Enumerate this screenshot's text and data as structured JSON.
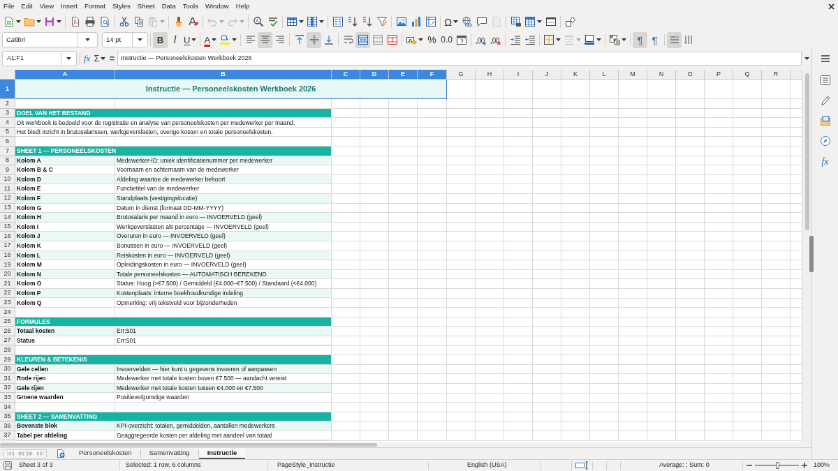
{
  "menu_bar": {
    "items": [
      "File",
      "Edit",
      "View",
      "Insert",
      "Format",
      "Styles",
      "Sheet",
      "Data",
      "Tools",
      "Window",
      "Help"
    ]
  },
  "standard_toolbar": [
    {
      "disabled": false
    },
    {
      "disabled": false
    },
    {
      "disabled": false
    },
    {
      "disabled": false
    },
    {
      "disabled": false
    },
    {
      "disabled": false
    },
    {
      "disabled": false
    },
    {
      "disabled": false
    },
    {
      "disabled": true
    },
    {
      "disabled": false
    },
    {
      "disabled": false
    },
    {
      "disabled": true
    },
    {
      "disabled": true
    },
    {
      "disabled": false
    },
    {
      "disabled": false
    },
    {
      "disabled": false
    },
    {
      "disabled": false
    },
    {
      "disabled": false
    },
    {
      "disabled": false
    },
    {
      "disabled": false
    },
    {
      "disabled": false
    },
    {
      "disabled": false
    },
    {
      "disabled": false
    },
    {
      "disabled": false
    },
    {
      "label": "Ω",
      "disabled": false
    },
    {
      "disabled": false
    },
    {
      "disabled": false
    },
    {
      "disabled": true
    },
    {
      "disabled": false
    },
    {
      "disabled": false
    },
    {
      "disabled": false
    },
    {
      "disabled": false
    }
  ],
  "formatting_toolbar": {
    "font_name": "Calibri",
    "font_size": "14 pt",
    "buttons": [
      {
        "label": "B",
        "on": true,
        "disabled": false
      },
      {
        "label": "I",
        "on": false,
        "disabled": false
      },
      {
        "label": "U",
        "on": false,
        "disabled": false
      },
      {
        "label": "A",
        "on": false,
        "disabled": false
      },
      {
        "on": false,
        "disabled": false
      },
      {
        "on": false,
        "disabled": false
      },
      {
        "on": true,
        "disabled": false
      },
      {
        "on": false,
        "disabled": false
      },
      {
        "on": false,
        "disabled": false
      },
      {
        "on": true,
        "disabled": false
      },
      {
        "on": false,
        "disabled": false
      },
      {
        "on": false,
        "disabled": false
      },
      {
        "on": true,
        "disabled": false
      },
      {
        "on": false,
        "disabled": false
      },
      {
        "on": false,
        "disabled": false
      },
      {
        "on": false,
        "disabled": false
      },
      {
        "label": "%",
        "on": false,
        "disabled": false
      },
      {
        "label": "0.0",
        "on": false,
        "disabled": false
      },
      {
        "on": false,
        "disabled": false
      },
      {
        "on": false,
        "disabled": false
      },
      {
        "on": false,
        "disabled": false
      },
      {
        "on": false,
        "disabled": false
      },
      {
        "on": false,
        "disabled": false
      },
      {
        "on": false,
        "disabled": false
      },
      {
        "on": false,
        "disabled": true
      },
      {
        "on": false,
        "disabled": false
      },
      {
        "on": false,
        "disabled": false
      },
      {
        "label": "¶",
        "on": true,
        "disabled": false
      },
      {
        "label": "¶",
        "on": false,
        "disabled": false
      },
      {
        "on": true,
        "disabled": false
      },
      {
        "on": false,
        "disabled": false
      }
    ]
  },
  "formula_bar": {
    "name_box": "A1:F1",
    "function_wizard": "fx",
    "sum": "Σ",
    "equals": "=",
    "content": "Instructie — Personeelskosten Werkboek 2026"
  },
  "sidebar": {
    "functions_label": "fx"
  },
  "columns": [
    {
      "name": "A",
      "selected": true
    },
    {
      "name": "B",
      "selected": true
    },
    {
      "name": "C",
      "selected": true
    },
    {
      "name": "D",
      "selected": true
    },
    {
      "name": "E",
      "selected": true
    },
    {
      "name": "F",
      "selected": true
    },
    {
      "name": "G",
      "selected": false
    },
    {
      "name": "H",
      "selected": false
    },
    {
      "name": "I",
      "selected": false
    },
    {
      "name": "J",
      "selected": false
    },
    {
      "name": "K",
      "selected": false
    },
    {
      "name": "L",
      "selected": false
    },
    {
      "name": "M",
      "selected": false
    },
    {
      "name": "N",
      "selected": false
    },
    {
      "name": "O",
      "selected": false
    },
    {
      "name": "P",
      "selected": false
    },
    {
      "name": "Q",
      "selected": false
    },
    {
      "name": "R",
      "selected": false
    }
  ],
  "rows": [
    {
      "number": "1",
      "selected": true,
      "kind": "title",
      "text": "Instructie — Personeelskosten Werkboek 2026"
    },
    {
      "number": "2",
      "selected": false,
      "kind": "blank"
    },
    {
      "number": "3",
      "selected": false,
      "kind": "section",
      "text": "DOEL VAN HET BESTAND"
    },
    {
      "number": "4",
      "selected": false,
      "kind": "note",
      "text": "Dit werkboek is bedoeld voor de registratie en analyse van personeelskosten per medewerker per maand."
    },
    {
      "number": "5",
      "selected": false,
      "kind": "note",
      "text": "Het biedt inzicht in brutosalarissen, werkgeverslasten, overige kosten en totale personeelskosten."
    },
    {
      "number": "6",
      "selected": false,
      "kind": "blank"
    },
    {
      "number": "7",
      "selected": false,
      "kind": "section",
      "text": "SHEET 1 — PERSONEELSKOSTEN"
    },
    {
      "number": "8",
      "selected": false,
      "kind": "entry",
      "shaded": true,
      "label": "Kolom A",
      "description": "Medewerker-ID: uniek identificatienummer per medewerker"
    },
    {
      "number": "9",
      "selected": false,
      "kind": "entry",
      "shaded": false,
      "label": "Kolom B & C",
      "description": "Voornaam en achternaam van de medewerker"
    },
    {
      "number": "10",
      "selected": false,
      "kind": "entry",
      "shaded": true,
      "label": "Kolom D",
      "description": "Afdeling waartoe de medewerker behoort"
    },
    {
      "number": "11",
      "selected": false,
      "kind": "entry",
      "shaded": false,
      "label": "Kolom E",
      "description": "Functietitel van de medewerker"
    },
    {
      "number": "12",
      "selected": false,
      "kind": "entry",
      "shaded": true,
      "label": "Kolom F",
      "description": "Standplaats (vestigingslocatie)"
    },
    {
      "number": "13",
      "selected": false,
      "kind": "entry",
      "shaded": false,
      "label": "Kolom G",
      "description": "Datum in dienst (formaat DD-MM-YYYY)"
    },
    {
      "number": "14",
      "selected": false,
      "kind": "entry",
      "shaded": true,
      "label": "Kolom H",
      "description": "Brutosalaris per maand in euro — INVOERVELD (geel)"
    },
    {
      "number": "15",
      "selected": false,
      "kind": "entry",
      "shaded": false,
      "label": "Kolom I",
      "description": "Werkgeverslasten als percentage — INVOERVELD (geel)"
    },
    {
      "number": "16",
      "selected": false,
      "kind": "entry",
      "shaded": true,
      "label": "Kolom J",
      "description": "Overuren in euro — INVOERVELD (geel)"
    },
    {
      "number": "17",
      "selected": false,
      "kind": "entry",
      "shaded": false,
      "label": "Kolom K",
      "description": "Bonussen in euro — INVOERVELD (geel)"
    },
    {
      "number": "18",
      "selected": false,
      "kind": "entry",
      "shaded": true,
      "label": "Kolom L",
      "description": "Reiskosten in euro — INVOERVELD (geel)"
    },
    {
      "number": "19",
      "selected": false,
      "kind": "entry",
      "shaded": false,
      "label": "Kolom M",
      "description": "Opleidingskosten in euro — INVOERVELD (geel)"
    },
    {
      "number": "20",
      "selected": false,
      "kind": "entry",
      "shaded": true,
      "label": "Kolom N",
      "description": "Totale personeelskosten — AUTOMATISCH BEREKEND"
    },
    {
      "number": "21",
      "selected": false,
      "kind": "entry",
      "shaded": false,
      "label": "Kolom O",
      "description": "Status: Hoog (>€7.500) / Gemiddeld (€4.000–€7.500) / Standaard (<€4.000)"
    },
    {
      "number": "22",
      "selected": false,
      "kind": "entry",
      "shaded": true,
      "label": "Kolom P",
      "description": "Kostenplaats: interne boekhoudkundige indeling"
    },
    {
      "number": "23",
      "selected": false,
      "kind": "entry",
      "shaded": false,
      "label": "Kolom Q",
      "description": "Opmerking: vrij tekstveld voor bijzonderheden"
    },
    {
      "number": "24",
      "selected": false,
      "kind": "blank"
    },
    {
      "number": "25",
      "selected": false,
      "kind": "section",
      "text": "FORMULES"
    },
    {
      "number": "26",
      "selected": false,
      "kind": "entry",
      "shaded": true,
      "label": "Totaal kosten",
      "description": "Err:501"
    },
    {
      "number": "27",
      "selected": false,
      "kind": "entry",
      "shaded": false,
      "label": "Status",
      "description": "Err:501"
    },
    {
      "number": "28",
      "selected": false,
      "kind": "blank"
    },
    {
      "number": "29",
      "selected": false,
      "kind": "section",
      "text": "KLEUREN & BETEKENIS"
    },
    {
      "number": "30",
      "selected": false,
      "kind": "entry",
      "shaded": true,
      "label": "Gele cellen",
      "description": "Invoervelden — hier kunt u gegevens invoeren of aanpassen"
    },
    {
      "number": "31",
      "selected": false,
      "kind": "entry",
      "shaded": false,
      "label": "Rode rijen",
      "description": "Medewerker met totale kosten boven €7.500 — aandacht vereist"
    },
    {
      "number": "32",
      "selected": false,
      "kind": "entry",
      "shaded": true,
      "label": "Gele rijen",
      "description": "Medewerker met totale kosten tussen €4.000 en €7.500"
    },
    {
      "number": "33",
      "selected": false,
      "kind": "entry",
      "shaded": false,
      "label": "Groene waarden",
      "description": "Positieve/gunstige waarden"
    },
    {
      "number": "34",
      "selected": false,
      "kind": "blank"
    },
    {
      "number": "35",
      "selected": false,
      "kind": "section",
      "text": "SHEET 2 — SAMENVATTING"
    },
    {
      "number": "36",
      "selected": false,
      "kind": "entry",
      "shaded": true,
      "label": "Bovenste blok",
      "description": "KPI-overzicht: totalen, gemiddelden, aantallen medewerkers"
    },
    {
      "number": "37",
      "selected": false,
      "kind": "entry",
      "shaded": false,
      "label": "Tabel per afdeling",
      "description": "Geaggregeerde kosten per afdeling met aandeel van totaal"
    }
  ],
  "sheet_navigation": [
    {
      "disabled": true
    },
    {
      "disabled": true
    },
    {
      "disabled": true
    },
    {
      "disabled": true
    }
  ],
  "sheet_tabs": [
    {
      "label": "Personeelskosten",
      "selected": false
    },
    {
      "label": "Samenvatting",
      "selected": false
    },
    {
      "label": "Instructie",
      "selected": true
    }
  ],
  "status_bar": {
    "sheet": "Sheet 3 of 3",
    "selection": "Selected: 1 row, 6 columns",
    "page_style": "PageStyle_Instructie",
    "language": "English (USA)",
    "summary": "Average: ; Sum: 0",
    "zoom": {
      "level": 0.5,
      "reading": "100%"
    }
  }
}
